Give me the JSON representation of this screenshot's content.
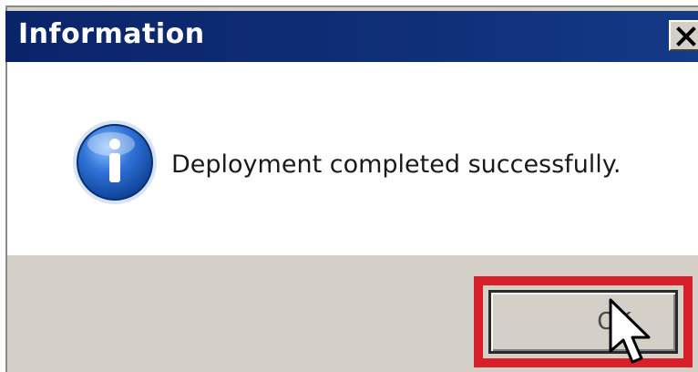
{
  "dialog": {
    "title": "Information",
    "message": "Deployment completed successfully.",
    "ok_label": "OK",
    "icons": {
      "info": "info-icon",
      "close": "close-icon",
      "cursor": "mouse-pointer-icon"
    },
    "colors": {
      "titlebar": "#0a246a",
      "highlight": "#d8202a",
      "face": "#d4d0c8"
    }
  }
}
